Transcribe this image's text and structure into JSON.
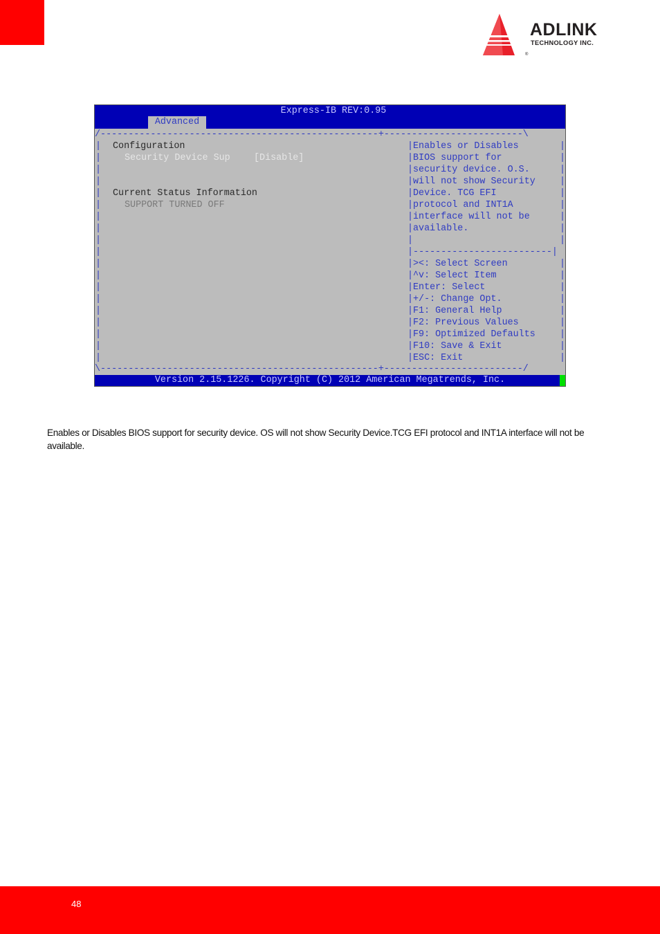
{
  "header": {
    "brand": "ADLINK",
    "brand_sub": "TECHNOLOGY INC.",
    "brand_reg": "®",
    "accent_color": "#ff0000"
  },
  "bios": {
    "title": "Express-IB REV:0.95",
    "active_tab": "Advanced",
    "border_top": "/--------------------------------------------------+-------------------------\\",
    "border_bottom": "\\--------------------------------------------------+-------------------------/",
    "help_divider": "|-------------------------|",
    "left": {
      "section1_heading": "Configuration",
      "setting_label": "Security Device Sup",
      "setting_value": "[Disable]",
      "section2_heading": "Current Status Information",
      "status_value": "SUPPORT TURNED OFF"
    },
    "help_text": [
      "Enables or Disables",
      "BIOS support for",
      "security device. O.S.",
      "will not show Security",
      "Device. TCG EFI",
      "protocol and INT1A",
      "interface will not be",
      "available."
    ],
    "key_help": [
      "><: Select Screen",
      "^v: Select Item",
      "Enter: Select",
      "+/-: Change Opt.",
      "F1: General Help",
      "F2: Previous Values",
      "F9: Optimized Defaults",
      "F10: Save & Exit",
      "ESC: Exit"
    ],
    "status_bar": "Version 2.15.1226. Copyright (C) 2012 American Megatrends, Inc.",
    "colors": {
      "title_bg": "#0000b5",
      "body_bg": "#bcbcbc",
      "text": "#2f3bc2",
      "highlight": "#e6e6e6",
      "cursor": "#00e000"
    }
  },
  "description": "Enables or Disables BIOS support for security device. OS will not show Security Device.TCG EFI protocol and INT1A interface will not be available.",
  "footer": {
    "page_number": "48"
  }
}
